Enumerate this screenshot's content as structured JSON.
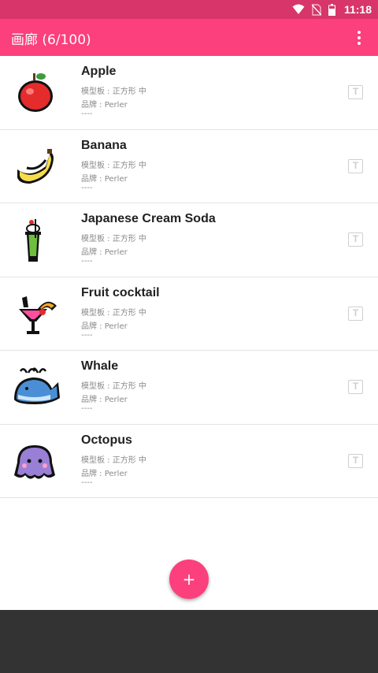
{
  "status_bar": {
    "time": "11:18",
    "color": "#d8356b"
  },
  "app_bar": {
    "title": "画廊 (6/100)",
    "menu_icon": "overflow-menu-icon",
    "color": "#fc3f7d"
  },
  "items": [
    {
      "name": "Apple",
      "template": "模型板 : 正方形 中",
      "brand": "品牌 : Perler",
      "note": "----",
      "thumbnail": "apple-pixel-art"
    },
    {
      "name": "Banana",
      "template": "模型板 : 正方形 中",
      "brand": "品牌 : Perler",
      "note": "----",
      "thumbnail": "banana-pixel-art"
    },
    {
      "name": "Japanese Cream Soda",
      "template": "模型板 : 正方形 中",
      "brand": "品牌 : Perler",
      "note": "----",
      "thumbnail": "cream-soda-pixel-art"
    },
    {
      "name": "Fruit cocktail",
      "template": "模型板 : 正方形 中",
      "brand": "品牌 : Perler",
      "note": "----",
      "thumbnail": "fruit-cocktail-pixel-art"
    },
    {
      "name": "Whale",
      "template": "模型板 : 正方形 中",
      "brand": "品牌 : Perler",
      "note": "----",
      "thumbnail": "whale-pixel-art"
    },
    {
      "name": "Octopus",
      "template": "模型板 : 正方形 中",
      "brand": "品牌 : Perler",
      "note": "----",
      "thumbnail": "octopus-pixel-art"
    }
  ],
  "text_button": {
    "label": "T",
    "icon": "text-icon"
  },
  "fab": {
    "label": "+",
    "icon": "add-icon"
  }
}
